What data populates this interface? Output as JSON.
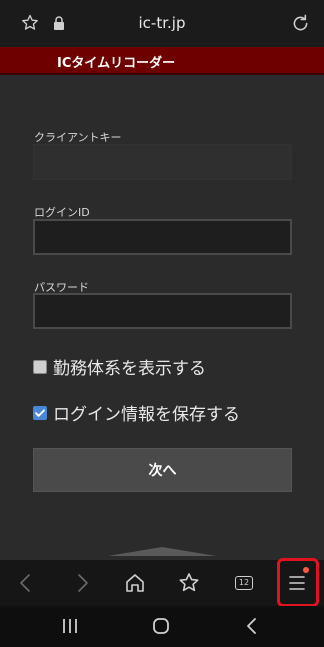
{
  "browser": {
    "url": "ic-tr.jp"
  },
  "header": {
    "title": "ICタイムリコーダー"
  },
  "form": {
    "client_key_label": "クライアントキー",
    "client_key_value": "",
    "login_id_label": "ログインID",
    "login_id_value": "",
    "password_label": "パスワード",
    "password_value": ""
  },
  "options": {
    "show_work_system_label": "勤務体系を表示する",
    "show_work_system_checked": false,
    "save_login_label": "ログイン情報を保存する",
    "save_login_checked": true
  },
  "actions": {
    "next_label": "次へ"
  },
  "toolbar": {
    "tab_count": "12"
  },
  "colors": {
    "header_bg": "#6e0000",
    "highlight": "#e0141e",
    "checkbox_on": "#4a87d6"
  },
  "icons": [
    "star-icon",
    "lock-icon",
    "reload-icon",
    "back-icon",
    "forward-icon",
    "home-icon",
    "bookmarks-icon",
    "tabs-icon",
    "menu-icon",
    "recent-apps-icon",
    "home-button-icon",
    "nav-back-icon"
  ]
}
